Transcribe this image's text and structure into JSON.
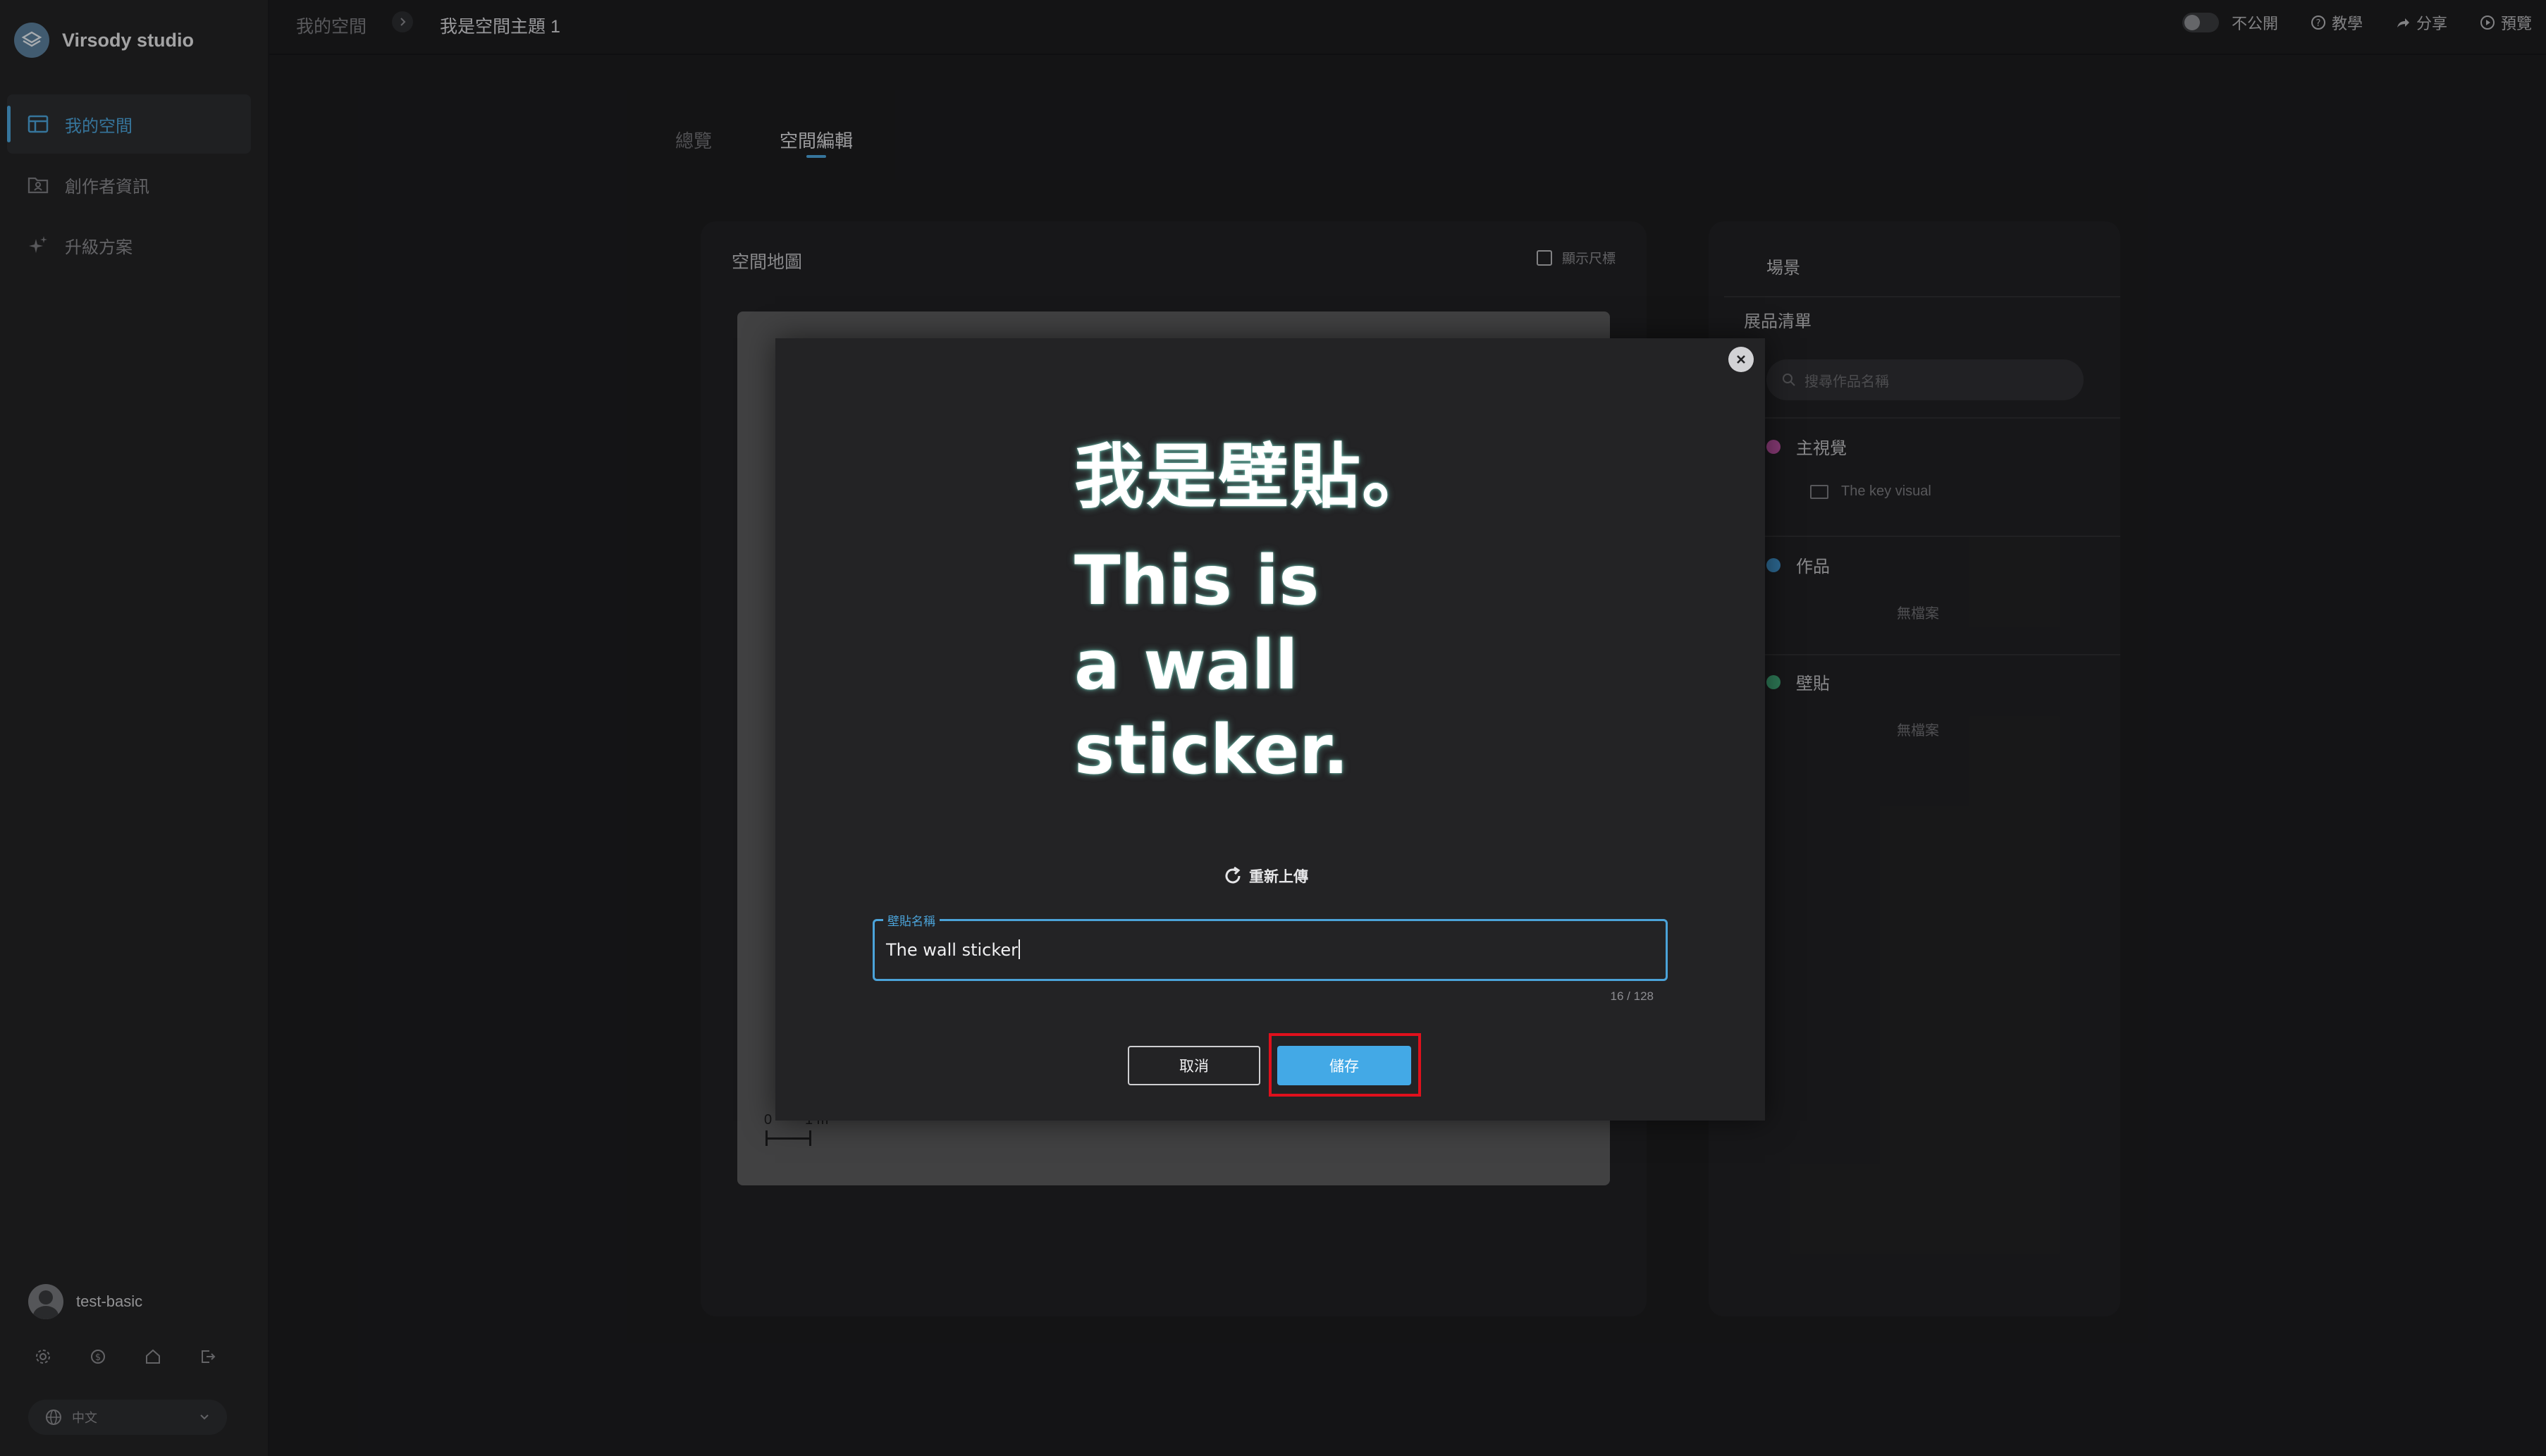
{
  "brand": {
    "name": "Virsody studio"
  },
  "sidebar": {
    "items": [
      {
        "label": "我的空間",
        "icon": "layout-icon",
        "active": true
      },
      {
        "label": "創作者資訊",
        "icon": "folder-person-icon",
        "active": false
      },
      {
        "label": "升級方案",
        "icon": "sparkle-icon",
        "active": false
      }
    ],
    "user": {
      "name": "test-basic"
    },
    "utilities": [
      "settings-icon",
      "coin-icon",
      "home-icon",
      "logout-icon"
    ],
    "language": {
      "value": "中文"
    }
  },
  "breadcrumb": {
    "root": "我的空間",
    "current": "我是空間主題 1"
  },
  "topbar": {
    "visibility_label": "不公開",
    "tutorial_label": "教學",
    "share_label": "分享",
    "preview_label": "預覽"
  },
  "tabs": {
    "overview": "總覽",
    "edit": "空間編輯"
  },
  "map_panel": {
    "title": "空間地圖",
    "show_scale_label": "顯示尺標",
    "scale": {
      "zero": "0",
      "one": "1 m"
    }
  },
  "right_panel": {
    "scene_label": "場景",
    "list_title": "展品清單",
    "search_placeholder": "搜尋作品名稱",
    "categories": [
      {
        "label": "主視覺",
        "color": "#b94fa0",
        "items": [
          "The key visual"
        ]
      },
      {
        "label": "作品",
        "color": "#3e8fc8",
        "empty_text": "無檔案"
      },
      {
        "label": "壁貼",
        "color": "#3fa676",
        "empty_text": "無檔案"
      }
    ]
  },
  "modal": {
    "sticker_zh": "我是壁貼。",
    "sticker_en": "This is a wall sticker.",
    "reupload_label": "重新上傳",
    "field_label": "壁貼名稱",
    "field_value": "The wall sticker",
    "char_count": "16 / 128",
    "cancel_label": "取消",
    "save_label": "儲存"
  },
  "colors": {
    "accent": "#4ba3d9",
    "save_button": "#43a9e6",
    "highlight": "#e0101c",
    "background": "#1c1c1e"
  }
}
